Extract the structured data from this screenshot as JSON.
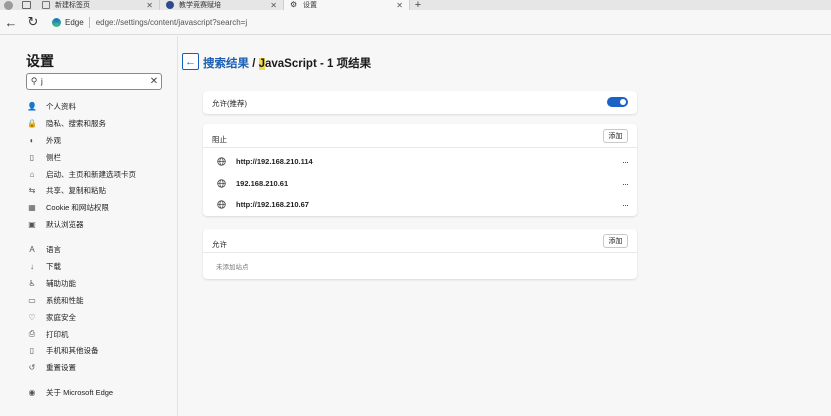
{
  "tabs": [
    {
      "label": "新建标签页"
    },
    {
      "label": "教学竞赛赋培"
    },
    {
      "label": "设置"
    }
  ],
  "address": {
    "brand": "Edge",
    "url": "edge://settings/content/javascript?search=j"
  },
  "sidebar": {
    "title": "设置",
    "search_value": "j",
    "items": [
      {
        "label": "个人资料",
        "icon": "person-icon"
      },
      {
        "label": "隐私、搜索和服务",
        "icon": "lock-icon"
      },
      {
        "label": "外观",
        "icon": "appearance-icon"
      },
      {
        "label": "侧栏",
        "icon": "sidebar-icon"
      },
      {
        "label": "启动、主页和新建选项卡页",
        "icon": "home-icon"
      },
      {
        "label": "共享、复制和粘贴",
        "icon": "share-icon"
      },
      {
        "label": "Cookie 和网站权限",
        "icon": "cookie-icon"
      },
      {
        "label": "默认浏览器",
        "icon": "browser-icon"
      },
      {
        "label": "语言",
        "icon": "language-icon"
      },
      {
        "label": "下载",
        "icon": "download-icon"
      },
      {
        "label": "辅助功能",
        "icon": "accessibility-icon"
      },
      {
        "label": "系统和性能",
        "icon": "system-icon"
      },
      {
        "label": "家庭安全",
        "icon": "family-icon"
      },
      {
        "label": "打印机",
        "icon": "printer-icon"
      },
      {
        "label": "手机和其他设备",
        "icon": "phone-icon"
      },
      {
        "label": "重置设置",
        "icon": "reset-icon"
      },
      {
        "label": "关于 Microsoft Edge",
        "icon": "edge-icon"
      }
    ]
  },
  "breadcrumb": {
    "link": "搜索结果",
    "sep": " / ",
    "highlight": "J",
    "rest": "avaScript - 1 项结果"
  },
  "allow_recommended": {
    "label": "允许(推荐)",
    "enabled": true
  },
  "block": {
    "title": "阻止",
    "add_label": "添加",
    "more_label": "···",
    "sites": [
      "http://192.168.210.114",
      "192.168.210.61",
      "http://192.168.210.67"
    ]
  },
  "allow": {
    "title": "允许",
    "add_label": "添加",
    "empty_text": "未添加站点"
  },
  "colors": {
    "accent": "#1a62c6",
    "link": "#1a5fb4",
    "highlight": "#f3da4b"
  }
}
